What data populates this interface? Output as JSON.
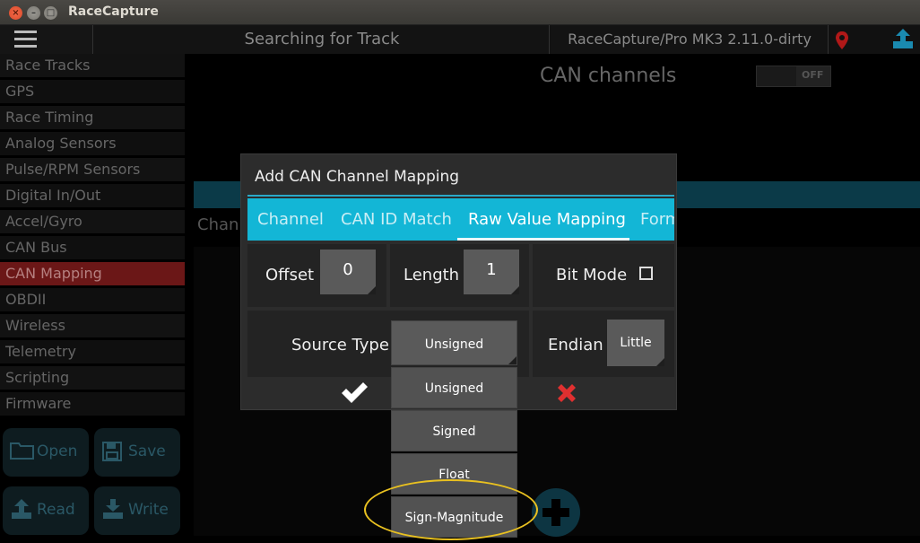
{
  "window": {
    "title": "RaceCapture"
  },
  "topbar": {
    "status": "Searching for Track",
    "device": "RaceCapture/Pro MK3 2.11.0-dirty"
  },
  "sidebar": {
    "items": [
      {
        "label": "Race Tracks"
      },
      {
        "label": "GPS"
      },
      {
        "label": "Race Timing"
      },
      {
        "label": "Analog Sensors"
      },
      {
        "label": "Pulse/RPM Sensors"
      },
      {
        "label": "Digital In/Out"
      },
      {
        "label": "Accel/Gyro"
      },
      {
        "label": "CAN Bus"
      },
      {
        "label": "CAN Mapping"
      },
      {
        "label": "OBDII"
      },
      {
        "label": "Wireless"
      },
      {
        "label": "Telemetry"
      },
      {
        "label": "Scripting"
      },
      {
        "label": "Firmware"
      }
    ],
    "active_index": 8,
    "buttons": {
      "open": "Open",
      "save": "Save",
      "read": "Read",
      "write": "Write"
    }
  },
  "main": {
    "title": "CAN channels",
    "toggle_label": "OFF",
    "channel_header": "Chann"
  },
  "dialog": {
    "title": "Add CAN Channel Mapping",
    "tabs": [
      {
        "label": "Channel"
      },
      {
        "label": "CAN ID Match"
      },
      {
        "label": "Raw Value Mapping"
      },
      {
        "label": "Form"
      }
    ],
    "active_tab": "Raw Value Mapping",
    "offset": {
      "label": "Offset",
      "value": "0"
    },
    "length": {
      "label": "Length",
      "value": "1"
    },
    "bit_mode": {
      "label": "Bit Mode",
      "checked": false
    },
    "source_type": {
      "label": "Source Type",
      "value": "Unsigned"
    },
    "endian": {
      "label": "Endian",
      "value": "Little"
    }
  },
  "dropdown": {
    "options": [
      "Unsigned",
      "Signed",
      "Float",
      "Sign-Magnitude"
    ]
  },
  "colors": {
    "accent": "#13b6d6",
    "active_sidebar": "#6b1717",
    "cancel": "#e03030",
    "highlight": "#e8c020"
  }
}
